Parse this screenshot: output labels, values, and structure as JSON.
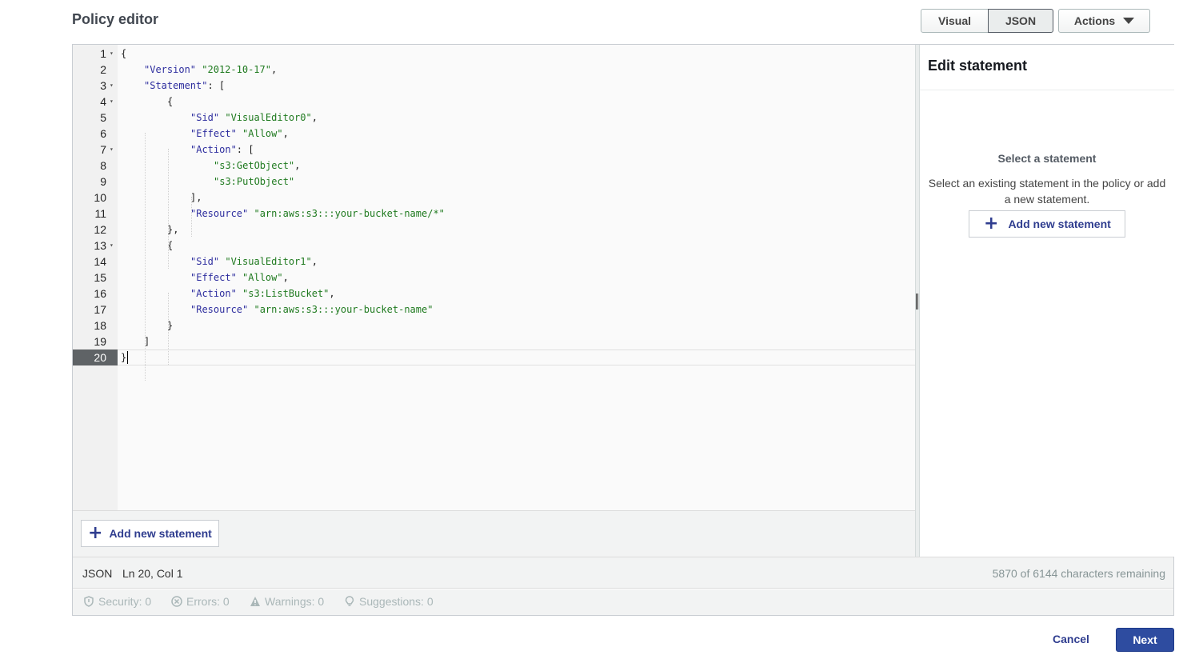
{
  "header": {
    "title": "Policy editor",
    "view_visual_label": "Visual",
    "view_json_label": "JSON",
    "actions_label": "Actions"
  },
  "editor": {
    "lines": [
      {
        "n": "1",
        "fold": true
      },
      {
        "n": "2"
      },
      {
        "n": "3",
        "fold": true
      },
      {
        "n": "4",
        "fold": true
      },
      {
        "n": "5"
      },
      {
        "n": "6"
      },
      {
        "n": "7",
        "fold": true
      },
      {
        "n": "8"
      },
      {
        "n": "9"
      },
      {
        "n": "10"
      },
      {
        "n": "11"
      },
      {
        "n": "12"
      },
      {
        "n": "13",
        "fold": true
      },
      {
        "n": "14"
      },
      {
        "n": "15"
      },
      {
        "n": "16"
      },
      {
        "n": "17"
      },
      {
        "n": "18"
      },
      {
        "n": "19"
      },
      {
        "n": "20",
        "active": true
      }
    ],
    "tokens": {
      "l1": "{",
      "l2_key": "\"Version\"",
      "l2_val": "\"2012-10-17\"",
      "l3_key": "\"Statement\"",
      "l3_rest": ": [",
      "l4": "{",
      "l5_key": "\"Sid\"",
      "l5_val": "\"VisualEditor0\"",
      "l6_key": "\"Effect\"",
      "l6_val": "\"Allow\"",
      "l7_key": "\"Action\"",
      "l7_rest": ": [",
      "l8_val": "\"s3:GetObject\"",
      "l9_val": "\"s3:PutObject\"",
      "l10": "],",
      "l11_key": "\"Resource\"",
      "l11_val": "\"arn:aws:s3:::your-bucket-name/*\"",
      "l12": "},",
      "l13": "{",
      "l14_key": "\"Sid\"",
      "l14_val": "\"VisualEditor1\"",
      "l15_key": "\"Effect\"",
      "l15_val": "\"Allow\"",
      "l16_key": "\"Action\"",
      "l16_val": "\"s3:ListBucket\"",
      "l17_key": "\"Resource\"",
      "l17_val": "\"arn:aws:s3:::your-bucket-name\"",
      "l18": "}",
      "l19": "]",
      "l20": "}"
    },
    "add_statement_label": "Add new statement"
  },
  "side_panel": {
    "title": "Edit statement",
    "heading": "Select a statement",
    "description": "Select an existing statement in the policy or add a new statement.",
    "add_statement_label": "Add new statement"
  },
  "status": {
    "language": "JSON",
    "position": "Ln 20, Col 1",
    "remaining": "5870 of 6144 characters remaining"
  },
  "validation": {
    "security": "Security: 0",
    "errors": "Errors: 0",
    "warnings": "Warnings: 0",
    "suggestions": "Suggestions: 0"
  },
  "footer": {
    "cancel_label": "Cancel",
    "next_label": "Next"
  },
  "colors": {
    "primary": "#2e4ca0",
    "link": "#2f3d8f",
    "json_key": "#2d2d9e",
    "json_string": "#1f7a1f"
  }
}
